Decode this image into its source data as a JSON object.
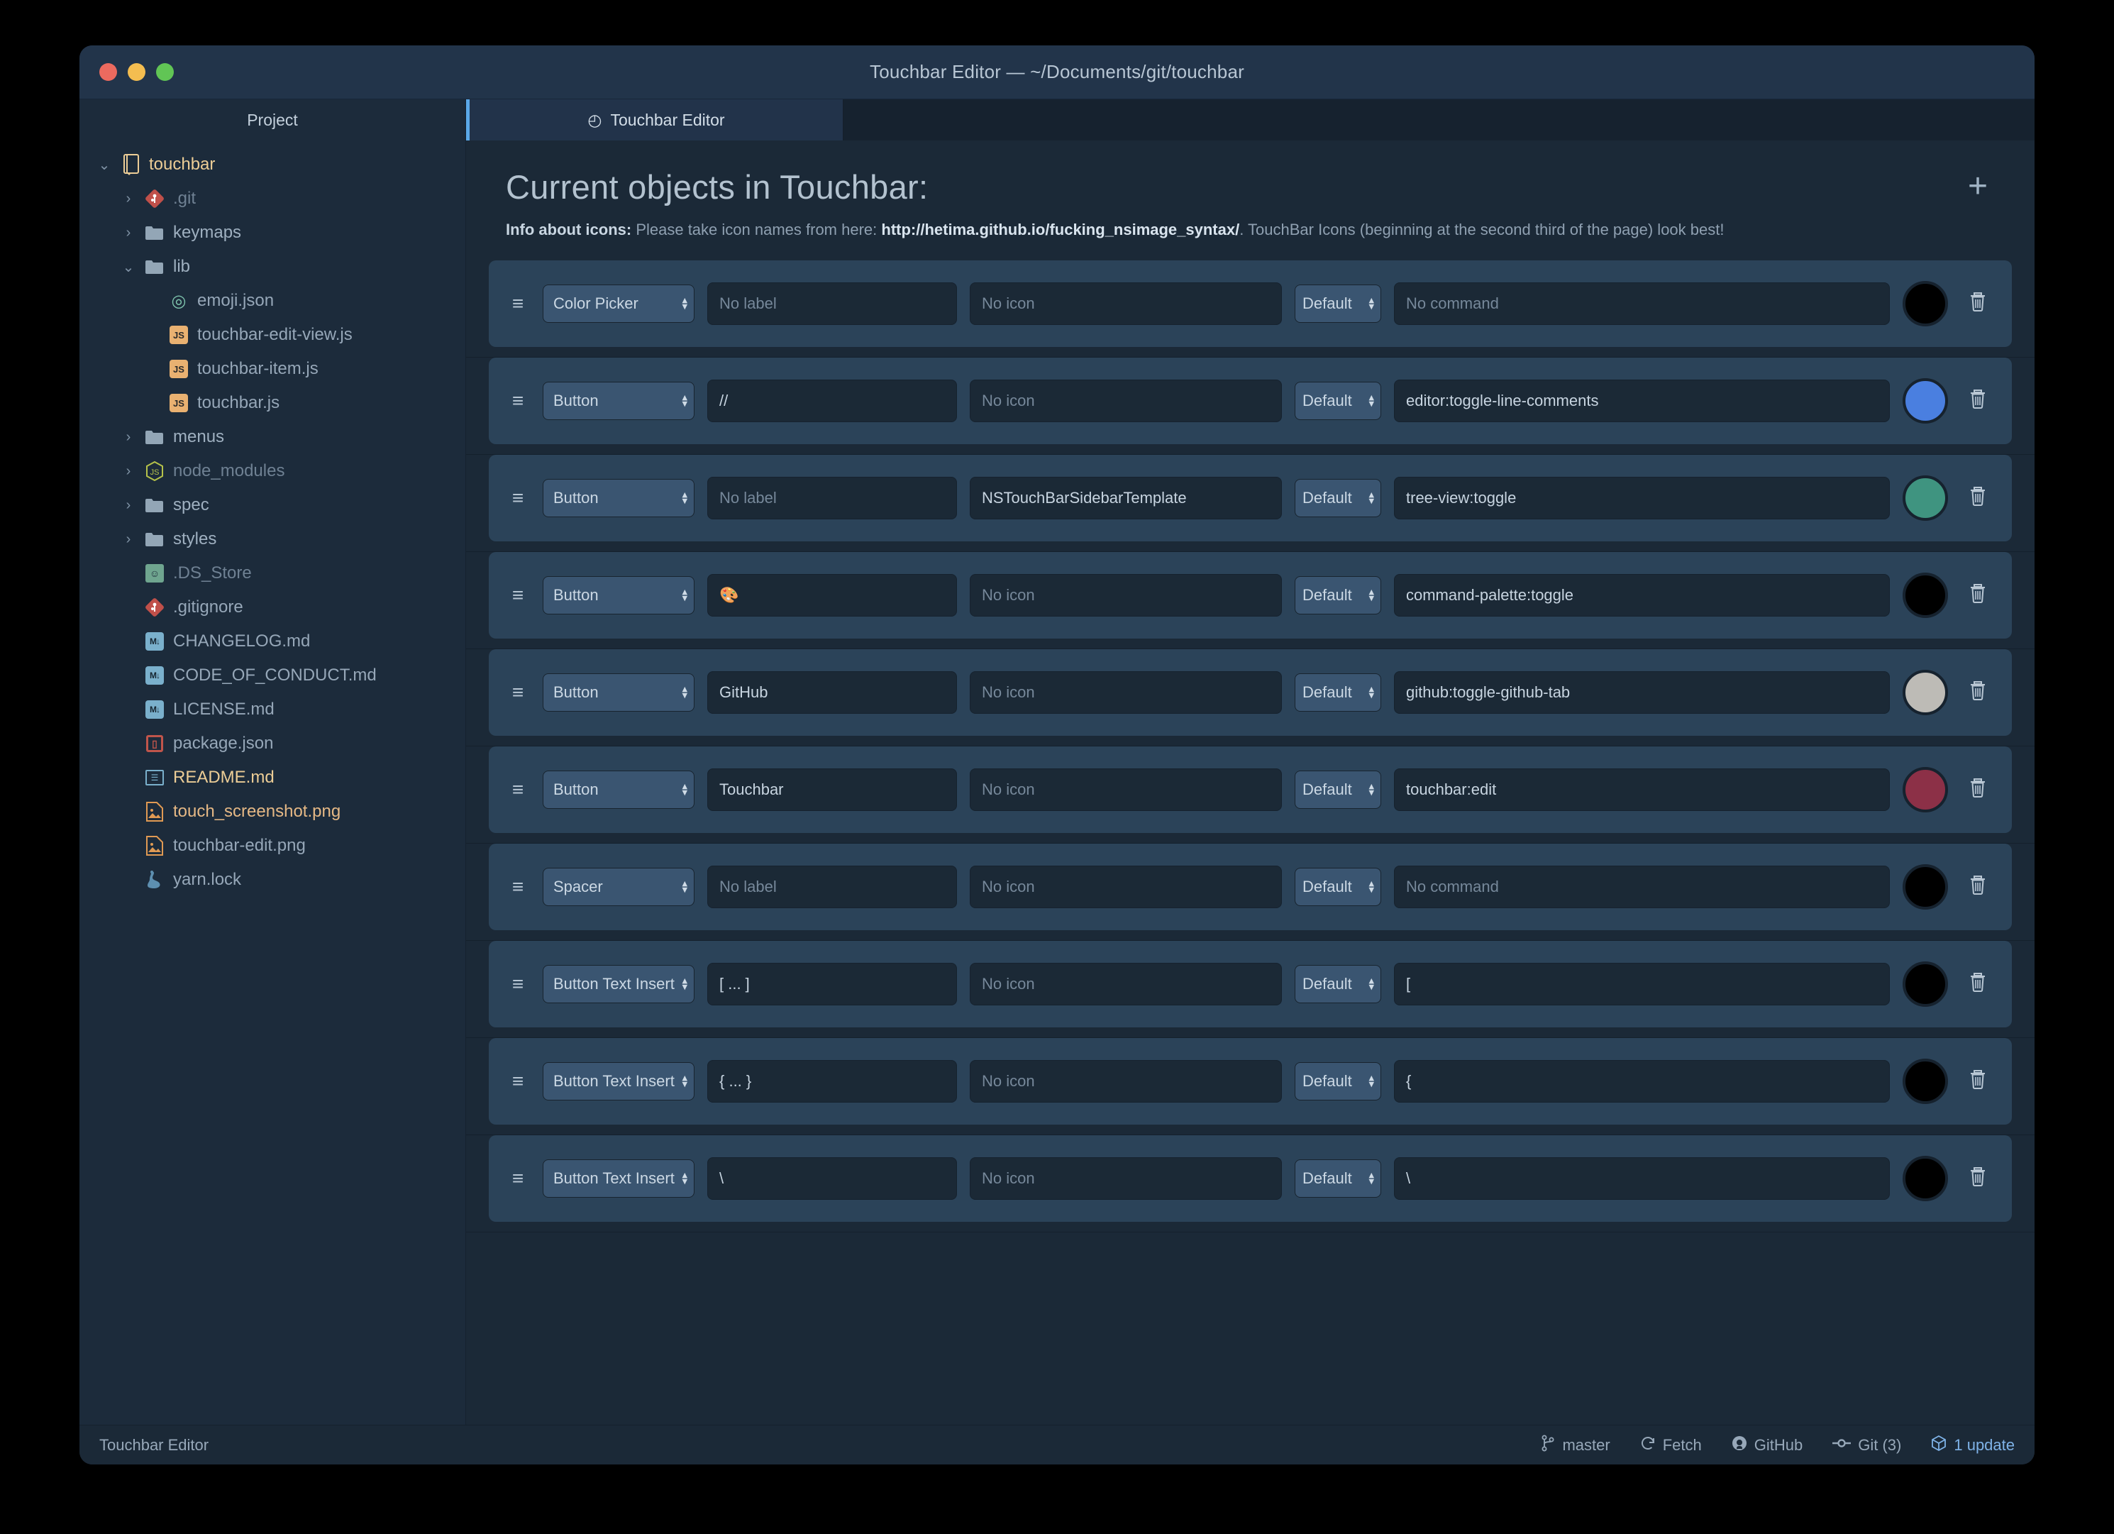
{
  "window": {
    "title": "Touchbar Editor — ~/Documents/git/touchbar",
    "traffic": {
      "close": "close-button",
      "minimize": "minimize-button",
      "zoom": "zoom-button"
    }
  },
  "sidebar": {
    "header": "Project",
    "tree": [
      {
        "label": "touchbar",
        "indent": 0,
        "twisty": "down",
        "icon": "project-book-icon",
        "style": "accent"
      },
      {
        "label": ".git",
        "indent": 1,
        "twisty": "right",
        "icon": "git-icon",
        "style": "dim"
      },
      {
        "label": "keymaps",
        "indent": 1,
        "twisty": "right",
        "icon": "folder-icon",
        "style": "folder"
      },
      {
        "label": "lib",
        "indent": 1,
        "twisty": "down",
        "icon": "folder-icon",
        "style": "folder"
      },
      {
        "label": "emoji.json",
        "indent": 2,
        "twisty": "none",
        "icon": "emoji-json-icon",
        "style": "normal"
      },
      {
        "label": "touchbar-edit-view.js",
        "indent": 2,
        "twisty": "none",
        "icon": "js-icon",
        "style": "normal"
      },
      {
        "label": "touchbar-item.js",
        "indent": 2,
        "twisty": "none",
        "icon": "js-icon",
        "style": "normal"
      },
      {
        "label": "touchbar.js",
        "indent": 2,
        "twisty": "none",
        "icon": "js-icon",
        "style": "normal"
      },
      {
        "label": "menus",
        "indent": 1,
        "twisty": "right",
        "icon": "folder-icon",
        "style": "folder"
      },
      {
        "label": "node_modules",
        "indent": 1,
        "twisty": "right",
        "icon": "node-icon",
        "style": "dim"
      },
      {
        "label": "spec",
        "indent": 1,
        "twisty": "right",
        "icon": "folder-icon",
        "style": "folder"
      },
      {
        "label": "styles",
        "indent": 1,
        "twisty": "right",
        "icon": "folder-icon",
        "style": "folder"
      },
      {
        "label": ".DS_Store",
        "indent": 1,
        "twisty": "none",
        "icon": "finder-icon",
        "style": "dim"
      },
      {
        "label": ".gitignore",
        "indent": 1,
        "twisty": "none",
        "icon": "git-icon",
        "style": "normal"
      },
      {
        "label": "CHANGELOG.md",
        "indent": 1,
        "twisty": "none",
        "icon": "markdown-icon",
        "style": "normal"
      },
      {
        "label": "CODE_OF_CONDUCT.md",
        "indent": 1,
        "twisty": "none",
        "icon": "markdown-icon",
        "style": "normal"
      },
      {
        "label": "LICENSE.md",
        "indent": 1,
        "twisty": "none",
        "icon": "markdown-icon",
        "style": "normal"
      },
      {
        "label": "package.json",
        "indent": 1,
        "twisty": "none",
        "icon": "npm-icon",
        "style": "normal"
      },
      {
        "label": "README.md",
        "indent": 1,
        "twisty": "none",
        "icon": "readme-icon",
        "style": "accent"
      },
      {
        "label": "touch_screenshot.png",
        "indent": 1,
        "twisty": "none",
        "icon": "image-icon",
        "style": "modified"
      },
      {
        "label": "touchbar-edit.png",
        "indent": 1,
        "twisty": "none",
        "icon": "image-icon",
        "style": "normal"
      },
      {
        "label": "yarn.lock",
        "indent": 1,
        "twisty": "none",
        "icon": "yarn-icon",
        "style": "normal"
      }
    ]
  },
  "tabs": [
    {
      "label": "Touchbar Editor",
      "icon": "touchbar-editor-icon",
      "active": true
    }
  ],
  "main": {
    "heading": "Current objects in Touchbar:",
    "add_label": "+",
    "info": {
      "bold": "Info about icons:",
      "pre": " Please take icon names from here: ",
      "link": "http://hetima.github.io/fucking_nsimage_syntax/",
      "post": ". TouchBar Icons (beginning at the second third of the page) look best!"
    },
    "placeholders": {
      "label": "No label",
      "icon": "No icon",
      "command": "No command"
    },
    "rows": [
      {
        "type": "Color Picker",
        "label": "",
        "icon": "",
        "mode": "Default",
        "command": "",
        "color": "#000000"
      },
      {
        "type": "Button",
        "label": "//",
        "icon": "",
        "mode": "Default",
        "command": "editor:toggle-line-comments",
        "color": "#4a7fe0"
      },
      {
        "type": "Button",
        "label": "",
        "icon": "NSTouchBarSidebarTemplate",
        "mode": "Default",
        "command": "tree-view:toggle",
        "color": "#3f9480"
      },
      {
        "type": "Button",
        "label": "🎨",
        "icon": "",
        "mode": "Default",
        "command": "command-palette:toggle",
        "color": "#000000"
      },
      {
        "type": "Button",
        "label": "GitHub",
        "icon": "",
        "mode": "Default",
        "command": "github:toggle-github-tab",
        "color": "#bdbbb6"
      },
      {
        "type": "Button",
        "label": "Touchbar",
        "icon": "",
        "mode": "Default",
        "command": "touchbar:edit",
        "color": "#8c3047"
      },
      {
        "type": "Spacer",
        "label": "",
        "icon": "",
        "mode": "Default",
        "command": "",
        "color": "#000000"
      },
      {
        "type": "Button Text Insert",
        "label": "[ ... ]",
        "icon": "",
        "mode": "Default",
        "command": "[",
        "color": "#000000"
      },
      {
        "type": "Button Text Insert",
        "label": "{ ... }",
        "icon": "",
        "mode": "Default",
        "command": "{",
        "color": "#000000"
      },
      {
        "type": "Button Text Insert",
        "label": "\\",
        "icon": "",
        "mode": "Default",
        "command": "\\",
        "color": "#000000"
      }
    ]
  },
  "statusbar": {
    "left": "Touchbar Editor",
    "items": [
      {
        "label": "master",
        "icon": "branch-icon",
        "link": false
      },
      {
        "label": "Fetch",
        "icon": "refresh-icon",
        "link": false
      },
      {
        "label": "GitHub",
        "icon": "github-icon",
        "link": false
      },
      {
        "label": "Git (3)",
        "icon": "commit-icon",
        "link": false
      },
      {
        "label": "1 update",
        "icon": "package-icon",
        "link": true
      }
    ]
  },
  "colors": {
    "accent": "#5aa8e8",
    "window_bg": "#1d2b3a",
    "row_bg": "#2b4359",
    "input_bg": "#1b2936"
  }
}
